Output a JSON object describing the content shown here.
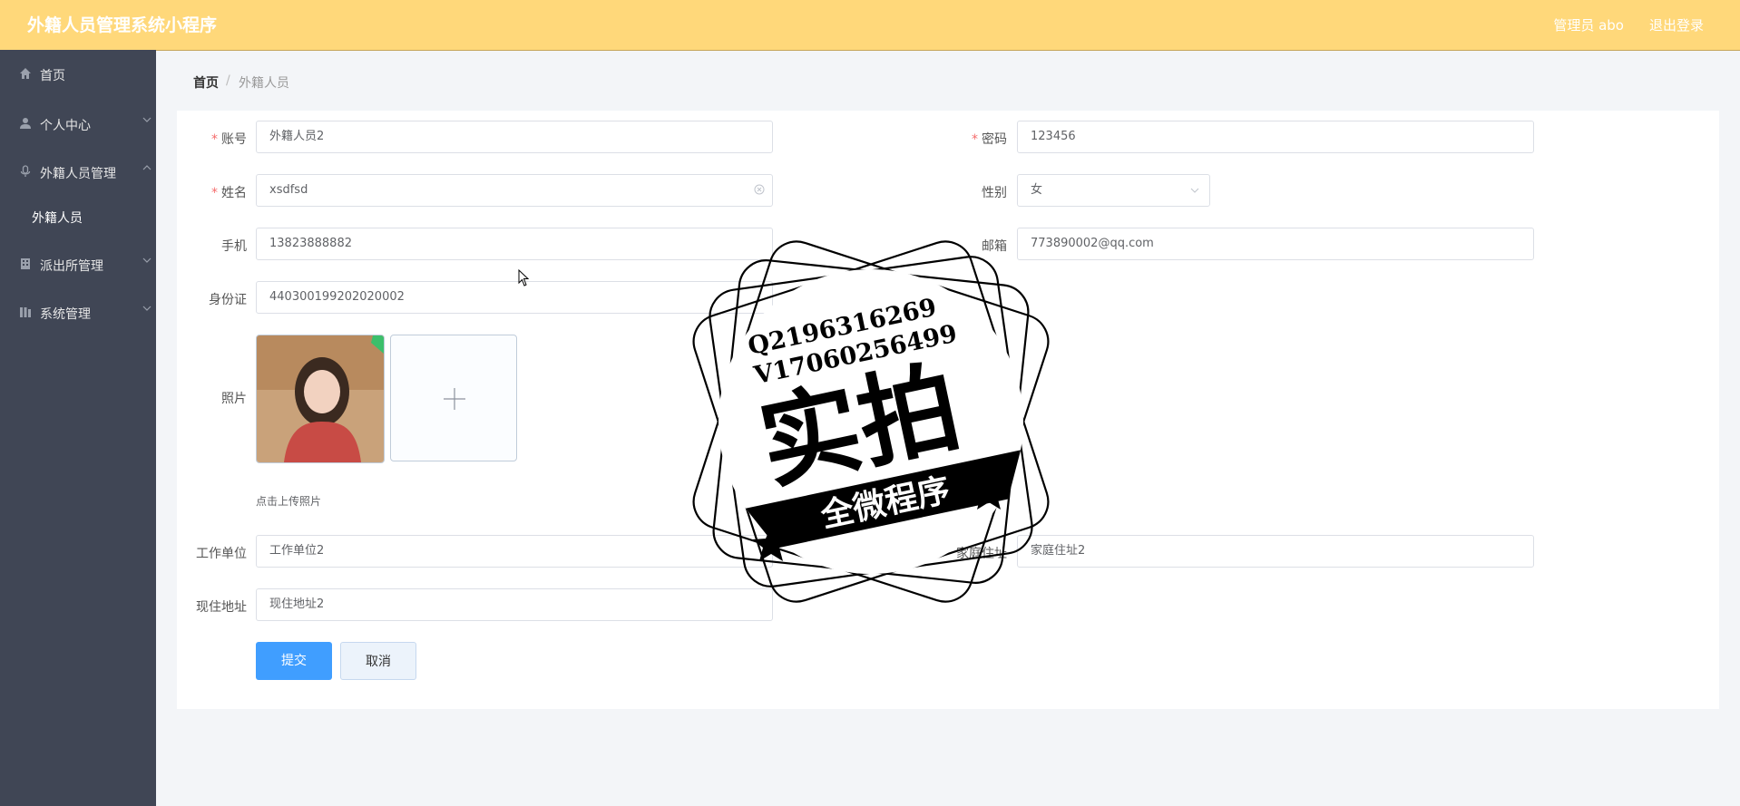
{
  "header": {
    "title": "外籍人员管理系统小程序",
    "user": "管理员 abo",
    "logout": "退出登录"
  },
  "sidebar": {
    "items": [
      {
        "label": "首页",
        "icon": "home-icon"
      },
      {
        "label": "个人中心",
        "icon": "user-icon"
      },
      {
        "label": "外籍人员管理",
        "icon": "mic-icon"
      },
      {
        "label": "外籍人员",
        "icon": ""
      },
      {
        "label": "派出所管理",
        "icon": "building-icon"
      },
      {
        "label": "系统管理",
        "icon": "library-icon"
      }
    ]
  },
  "breadcrumb": {
    "home": "首页",
    "separator": "/",
    "current": "外籍人员"
  },
  "form": {
    "account": {
      "label": "账号",
      "value": "外籍人员2"
    },
    "password": {
      "label": "密码",
      "value": "123456"
    },
    "name": {
      "label": "姓名",
      "value": "xsdfsd"
    },
    "gender": {
      "label": "性别",
      "value": "女"
    },
    "phone": {
      "label": "手机",
      "value": "13823888882"
    },
    "email": {
      "label": "邮箱",
      "value": "773890002@qq.com"
    },
    "id_card": {
      "label": "身份证",
      "value": "440300199202020002"
    },
    "photo": {
      "label": "照片",
      "hint": "点击上传照片"
    },
    "work_unit": {
      "label": "工作单位",
      "value": "工作单位2"
    },
    "home_address": {
      "label": "家庭住址",
      "value": "家庭住址2"
    },
    "current_address": {
      "label": "现住地址",
      "value": "现住地址2"
    },
    "required_mark": "*"
  },
  "buttons": {
    "submit": "提交",
    "cancel": "取消"
  },
  "watermark": {
    "line1": "Q2196316269",
    "line2": "V17060256499",
    "big": "实拍",
    "ribbon": "全微程序"
  },
  "colors": {
    "header": "#ffd87a",
    "sidebar": "#404655",
    "primary": "#409eff",
    "required": "#f56c6c"
  }
}
